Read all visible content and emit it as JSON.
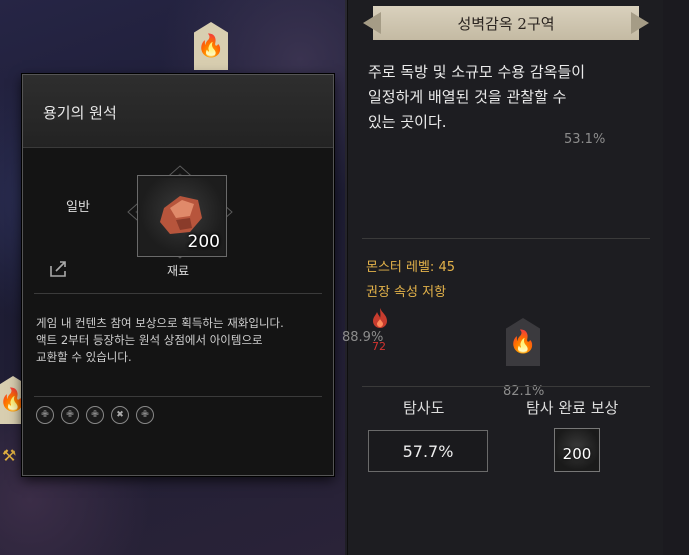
{
  "item_tooltip": {
    "title": "용기의 원석",
    "grade": "일반",
    "count": "200",
    "type": "재료",
    "description_lines": [
      "게임 내 컨텐츠 참여 보상으로 획득하는 재화입니다.",
      "액트 2부터 등장하는 원석 상점에서 아이템으로",
      "교환할 수 있습니다."
    ],
    "tag_icons": [
      "class-tag-icon-1",
      "class-tag-icon-2",
      "class-tag-icon-3",
      "class-tag-icon-4",
      "class-tag-icon-5"
    ]
  },
  "region_panel": {
    "title": "성벽감옥 2구역",
    "description_lines": [
      "주로 독방 및 소규모 수용 감옥들이",
      "일정하게 배열된 것을 관찰할 수",
      "있는 곳이다."
    ],
    "monster_level": "몬스터 레벨: 45",
    "resist_title": "권장 속성 저항",
    "fire_resist_value": "72",
    "exploration_label": "탐사도",
    "exploration_value": "57.7%",
    "reward_label": "탐사 완료 보상",
    "reward_count": "200"
  },
  "map": {
    "pct_a": "53.1%",
    "pct_b": "88.9%",
    "pct_c": "82.1%"
  },
  "colors": {
    "accent_gold": "#e3b24a",
    "fire_red": "#d4332f",
    "header_parchment": "#d9d1bd"
  }
}
